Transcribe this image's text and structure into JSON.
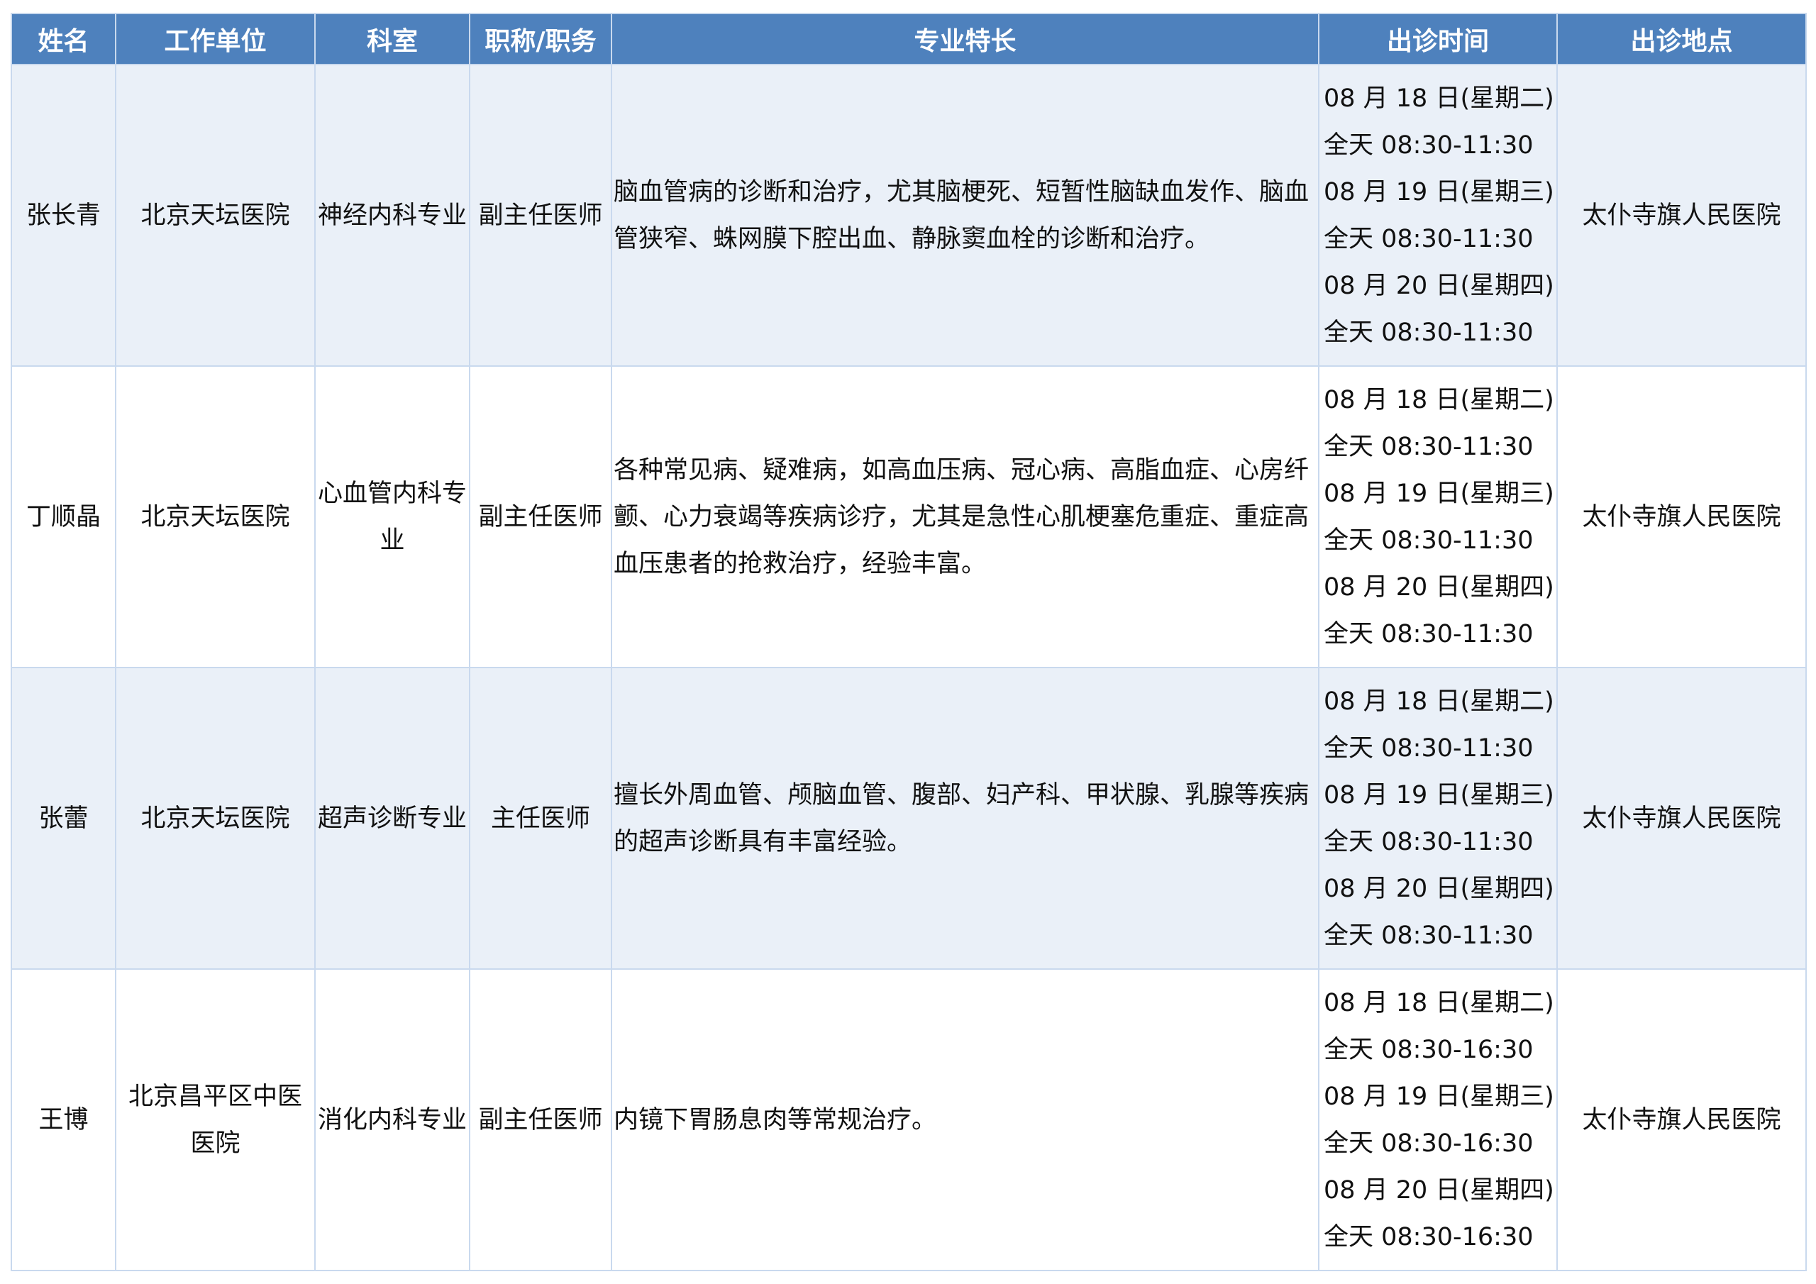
{
  "headers": [
    "姓名",
    "工作单位",
    "科室",
    "职称/职务",
    "专业特长",
    "出诊时间",
    "出诊地点"
  ],
  "rows": [
    {
      "name": "张长青",
      "workplace": "北京天坛医院",
      "department": "神经内科专业",
      "title": "副主任医师",
      "specialty": "脑血管病的诊断和治疗，尤其脑梗死、短暂性脑缺血发作、脑血管狭窄、蛛网膜下腔出血、静脉窦血栓的诊断和治疗。",
      "schedule": [
        "08 月 18 日(星期二)",
        "全天 08:30-11:30",
        "08 月 19 日(星期三)",
        "全天 08:30-11:30",
        "08 月 20 日(星期四)",
        "全天 08:30-11:30"
      ],
      "location": "太仆寺旗人民医院"
    },
    {
      "name": "丁顺晶",
      "workplace": "北京天坛医院",
      "department": "心血管内科专业",
      "title": "副主任医师",
      "specialty": "各种常见病、疑难病，如高血压病、冠心病、高脂血症、心房纤颤、心力衰竭等疾病诊疗，尤其是急性心肌梗塞危重症、重症高血压患者的抢救治疗，经验丰富。",
      "schedule": [
        "08 月 18 日(星期二)",
        "全天 08:30-11:30",
        "08 月 19 日(星期三)",
        "全天 08:30-11:30",
        "08 月 20 日(星期四)",
        "全天 08:30-11:30"
      ],
      "location": "太仆寺旗人民医院"
    },
    {
      "name": "张蕾",
      "workplace": "北京天坛医院",
      "department": "超声诊断专业",
      "title": "主任医师",
      "specialty": "擅长外周血管、颅脑血管、腹部、妇产科、甲状腺、乳腺等疾病的超声诊断具有丰富经验。",
      "schedule": [
        "08 月 18 日(星期二)",
        "全天 08:30-11:30",
        "08 月 19 日(星期三)",
        "全天 08:30-11:30",
        "08 月 20 日(星期四)",
        "全天 08:30-11:30"
      ],
      "location": "太仆寺旗人民医院"
    },
    {
      "name": "王博",
      "workplace": "北京昌平区中医医院",
      "department": "消化内科专业",
      "title": "副主任医师",
      "specialty": "内镜下胃肠息肉等常规治疗。",
      "schedule": [
        "08 月 18 日(星期二)",
        "全天 08:30-16:30",
        "08 月 19 日(星期三)",
        "全天 08:30-16:30",
        "08 月 20 日(星期四)",
        "全天 08:30-16:30"
      ],
      "location": "太仆寺旗人民医院"
    }
  ]
}
